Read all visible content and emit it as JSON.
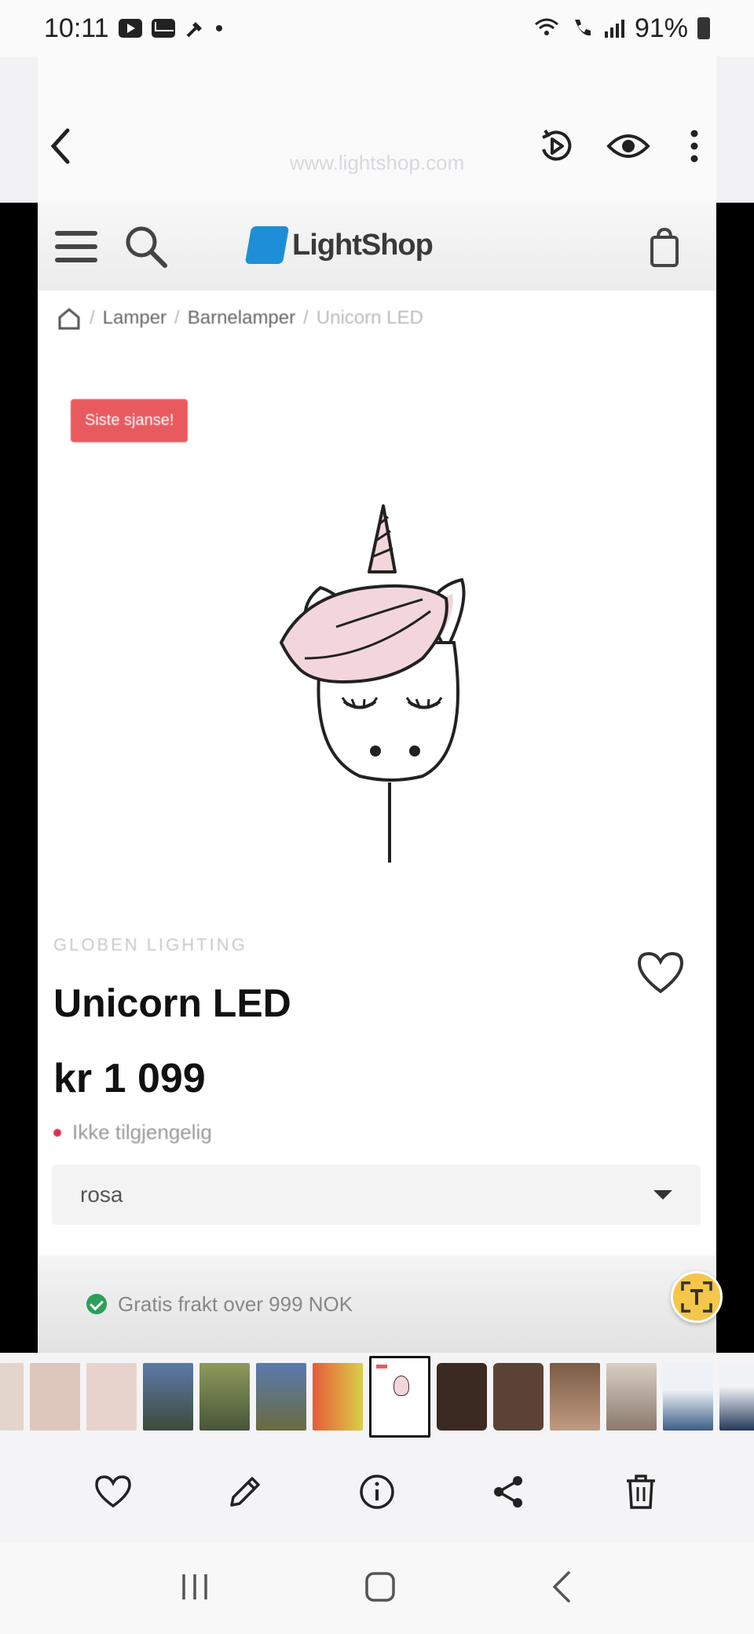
{
  "status_bar": {
    "time": "10:11",
    "icons_left": [
      "youtube-icon",
      "mail-icon",
      "tool-icon",
      "dot-icon"
    ],
    "icons_right": [
      "wifi-calling-icon",
      "call-icon",
      "signal-icon",
      "battery-icon"
    ],
    "battery": "91%"
  },
  "viewer": {
    "back_icon": "chevron-left-icon",
    "header_icons": [
      "motion-photo-icon",
      "eye-icon",
      "more-vert-icon"
    ],
    "ghost_text": "www.lightshop.com"
  },
  "website": {
    "logo_text": "LightShop",
    "breadcrumb": [
      "Lamper",
      "Barnelamper",
      "Unicorn LED"
    ],
    "badge": "Siste sjanse!",
    "brand": "GLOBEN LIGHTING",
    "product_title": "Unicorn LED",
    "price": "kr 1 099",
    "stock_status": "Ikke tilgjengelig",
    "variant_selected": "rosa",
    "shipping_note": "Gratis frakt over 999 NOK",
    "colors": {
      "accent_blue": "#1e8fd6",
      "badge_red": "#e95a5f",
      "stock_red": "#d8334a",
      "ok_green": "#2aa05a"
    }
  },
  "thumbnails": {
    "count_visible": 14,
    "current_index": 7,
    "colors": [
      "#d9c9c0",
      "#e4cfc8",
      "#3f4a6b",
      "#66704b",
      "#5a6b88",
      "#bf8a6e",
      "#ffffff",
      "#4a3a30",
      "#6b4a3a",
      "#a78b6f",
      "#caa99a",
      "#5b7696",
      "#2f4566"
    ]
  },
  "actions": {
    "icons": [
      "heart-icon",
      "pencil-icon",
      "info-icon",
      "share-icon",
      "trash-icon"
    ]
  },
  "navbar": {
    "icons": [
      "recents-icon",
      "home-icon",
      "back-icon"
    ]
  }
}
